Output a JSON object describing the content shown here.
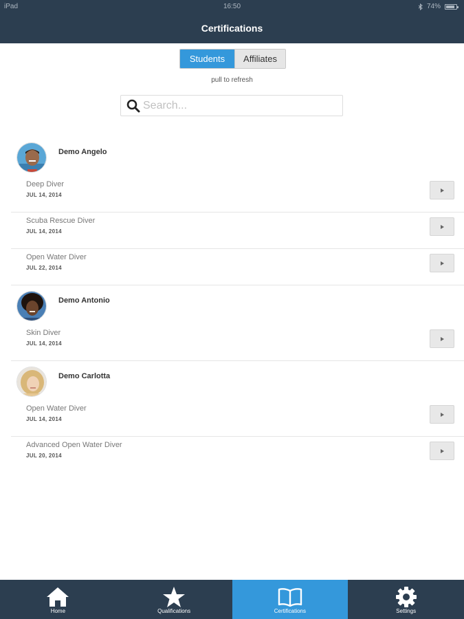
{
  "status_bar": {
    "device": "iPad",
    "time": "16:50",
    "battery": "74%"
  },
  "header": {
    "title": "Certifications"
  },
  "segments": {
    "students": "Students",
    "affiliates": "Affiliates"
  },
  "refresh_hint": "pull to refresh",
  "search": {
    "placeholder": "Search..."
  },
  "students": [
    {
      "name": "Demo Angelo",
      "certifications": [
        {
          "name": "Deep Diver",
          "date": "JUL 14, 2014"
        },
        {
          "name": "Scuba Rescue Diver",
          "date": "JUL 14, 2014"
        },
        {
          "name": "Open Water Diver",
          "date": "JUL 22, 2014"
        }
      ]
    },
    {
      "name": "Demo Antonio",
      "certifications": [
        {
          "name": "Skin Diver",
          "date": "JUL 14, 2014"
        }
      ]
    },
    {
      "name": "Demo Carlotta",
      "certifications": [
        {
          "name": "Open Water Diver",
          "date": "JUL 14, 2014"
        },
        {
          "name": "Advanced Open Water Diver",
          "date": "JUL 20, 2014"
        }
      ]
    }
  ],
  "tabs": [
    {
      "label": "Home",
      "icon": "home-icon"
    },
    {
      "label": "Qualifications",
      "icon": "star-icon"
    },
    {
      "label": "Certifications",
      "icon": "book-icon"
    },
    {
      "label": "Settings",
      "icon": "gear-icon"
    }
  ],
  "colors": {
    "navbar": "#2c3e50",
    "accent": "#3498db"
  }
}
